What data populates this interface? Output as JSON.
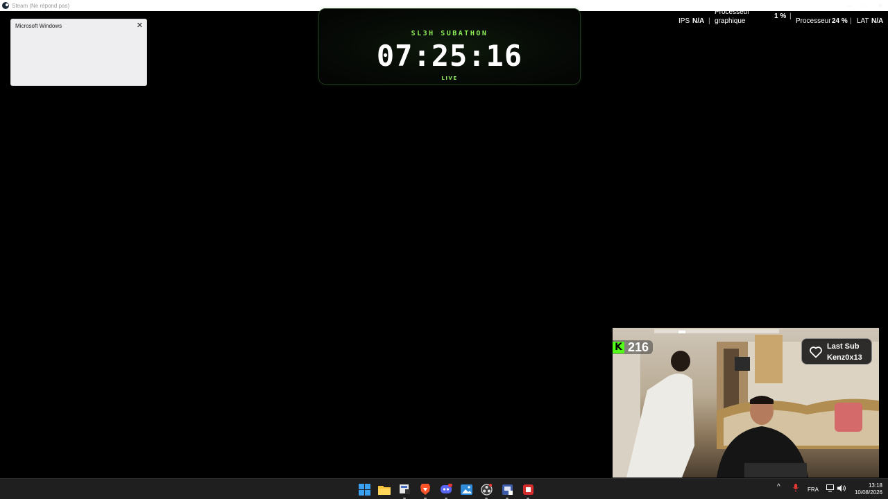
{
  "window": {
    "title": "Steam (Ne répond pas)"
  },
  "notification": {
    "title": "Microsoft Windows",
    "close_icon": "close-icon"
  },
  "timer": {
    "title": "SL3H SUBATHON",
    "value": "07:25:16",
    "status": "LIVE",
    "accent_color": "#8ff05a"
  },
  "perf_overlay": {
    "ips_label": "IPS",
    "ips_value": "N/A",
    "gpu_label_line1": "Processeur",
    "gpu_label_line2": "graphique",
    "gpu_value": "1 %",
    "cpu_label": "Processeur",
    "cpu_value": "24 %",
    "lat_label": "LAT",
    "lat_value": "N/A",
    "separator": "|"
  },
  "webcam": {
    "viewer_count": "216",
    "viewer_icon": "kick-logo-icon",
    "kick_color": "#53fc18",
    "last_sub_title": "Last Sub",
    "last_sub_user": "Kenz0x13",
    "heart_icon": "heart-icon"
  },
  "taskbar": {
    "apps": [
      {
        "name": "start-button",
        "icon": "windows-logo-icon"
      },
      {
        "name": "file-explorer",
        "icon": "folder-icon"
      },
      {
        "name": "app-3",
        "icon": "app-window-icon"
      },
      {
        "name": "brave-browser",
        "icon": "brave-lion-icon"
      },
      {
        "name": "discord",
        "icon": "discord-icon",
        "badge": "9+"
      },
      {
        "name": "photos",
        "icon": "photos-icon"
      },
      {
        "name": "obs-studio",
        "icon": "obs-icon"
      },
      {
        "name": "app-8",
        "icon": "app-window-icon"
      },
      {
        "name": "app-9",
        "icon": "app-red-icon"
      }
    ],
    "tray": {
      "chevron": "^",
      "language": "FRA"
    },
    "clock": {
      "time": "13:18",
      "date": "10/08/2026"
    }
  }
}
